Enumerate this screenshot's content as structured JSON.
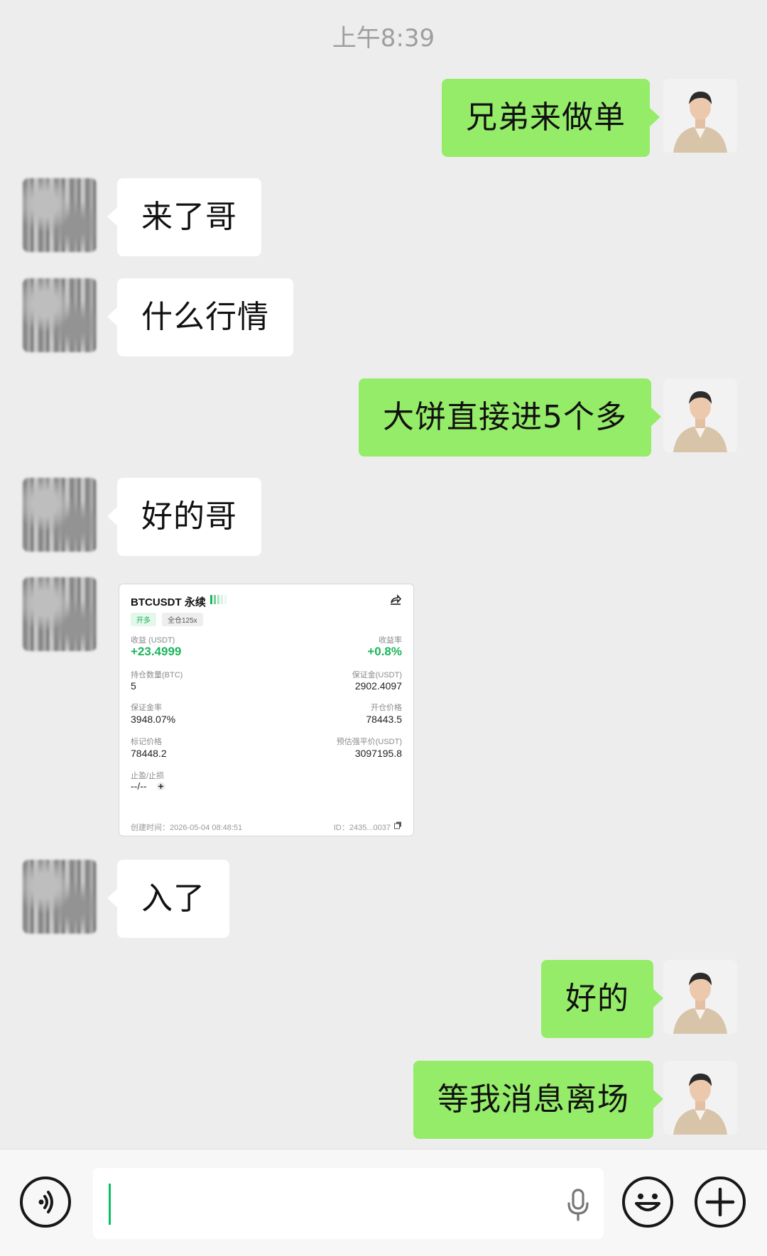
{
  "timestamp": "上午8:39",
  "messages": [
    {
      "side": "self",
      "text": "兄弟来做单"
    },
    {
      "side": "other",
      "text": "来了哥"
    },
    {
      "side": "other",
      "text": "什么行情"
    },
    {
      "side": "self",
      "text": "大饼直接进5个多"
    },
    {
      "side": "other",
      "text": "好的哥"
    },
    {
      "side": "other",
      "type": "image"
    },
    {
      "side": "other",
      "text": "入了"
    },
    {
      "side": "self",
      "text": "好的"
    },
    {
      "side": "self",
      "text": "等我消息离场"
    }
  ],
  "card": {
    "symbol": "BTCUSDT 永续",
    "tag_direction": "开多",
    "tag_margin": "全仓125x",
    "pnl_label": "收益 (USDT)",
    "pnl_value": "+23.4999",
    "roi_label": "收益率",
    "roi_value": "+0.8%",
    "size_label": "持仓数量(BTC)",
    "size_value": "5",
    "margin_label": "保证金(USDT)",
    "margin_value": "2902.4097",
    "margin_ratio_label": "保证金率",
    "margin_ratio_value": "3948.07%",
    "entry_label": "开仓价格",
    "entry_value": "78443.5",
    "mark_label": "标记价格",
    "mark_value": "78448.2",
    "liq_label": "预估强平价(USDT)",
    "liq_value": "3097195.8",
    "tpsl_label": "止盈/止损",
    "tpsl_value": "--/--",
    "created": "创建时间：2026-05-04 08:48:51",
    "order_id": "ID：2435...0037"
  },
  "input": {
    "value": ""
  },
  "colors": {
    "self_bubble": "#95ec69",
    "other_bubble": "#ffffff",
    "background": "#ededed",
    "accent_green": "#1cb45c",
    "caret": "#07c160"
  },
  "icons": [
    "voice-toggle-icon",
    "microphone-icon",
    "emoji-icon",
    "plus-icon",
    "share-icon",
    "copy-icon"
  ]
}
